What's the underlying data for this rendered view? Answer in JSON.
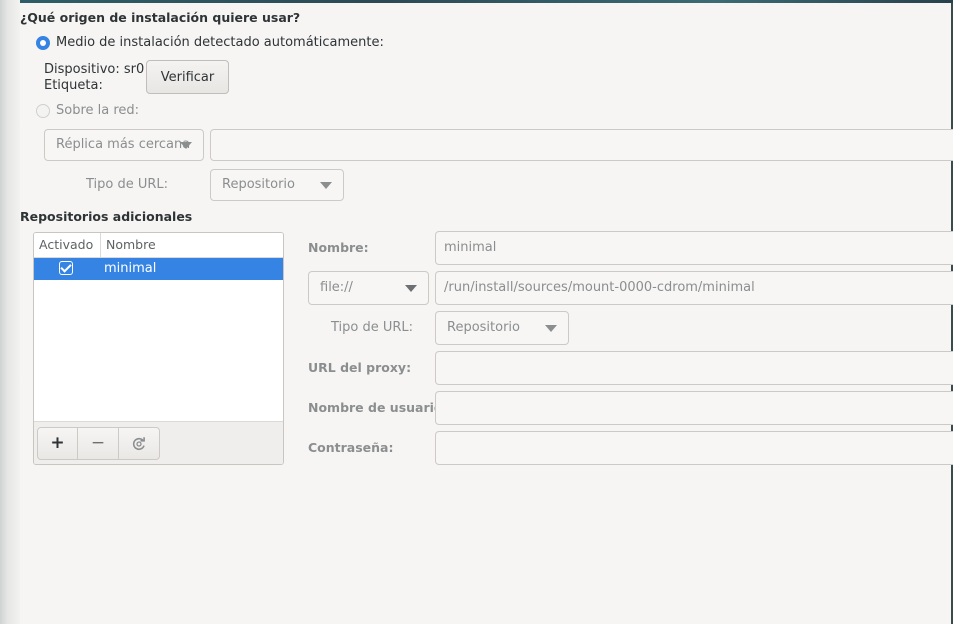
{
  "source": {
    "heading": "¿Qué origen de instalación quiere usar?",
    "auto_label": "Medio de instalación detectado automáticamente:",
    "device_label": "Dispositivo: sr0",
    "tag_label": "Etiqueta:",
    "verify_button": "Verificar",
    "network_label": "Sobre la red:",
    "mirror_combo": "Réplica más cercana",
    "url_type_label": "Tipo de URL:",
    "url_type_value": "Repositorio",
    "url_input_value": ""
  },
  "repos": {
    "heading": "Repositorios adicionales",
    "columns": {
      "enabled": "Activado",
      "name": "Nombre"
    },
    "rows": [
      {
        "enabled": true,
        "name": "minimal"
      }
    ],
    "toolbar": {
      "add": "+",
      "remove": "−",
      "refresh_icon": "refresh-icon"
    }
  },
  "repo_form": {
    "name_label": "Nombre:",
    "name_value": "minimal",
    "protocol_value": "file://",
    "url_value": "/run/install/sources/mount-0000-cdrom/minimal",
    "url_type_label": "Tipo de URL:",
    "url_type_value": "Repositorio",
    "proxy_label": "URL del proxy:",
    "proxy_value": "",
    "user_label": "Nombre de usuario:",
    "user_value": "",
    "password_label": "Contraseña:",
    "password_value": ""
  },
  "colors": {
    "accent": "#3584e4",
    "background": "#f6f5f4"
  }
}
